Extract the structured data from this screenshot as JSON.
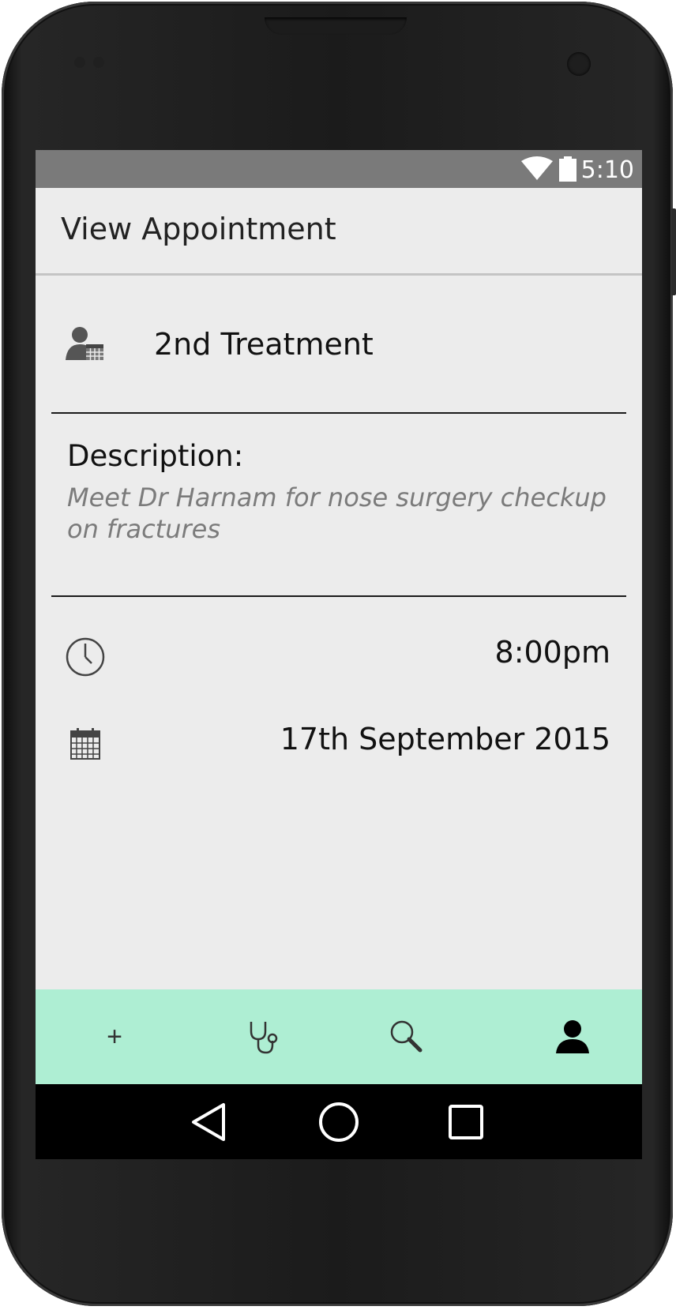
{
  "status_bar": {
    "time": "5:10",
    "wifi_icon": "wifi-icon",
    "battery_icon": "battery-icon"
  },
  "app_bar": {
    "title": "View Appointment"
  },
  "appointment": {
    "icon": "patient-calendar-icon",
    "name": "2nd Treatment",
    "description_label": "Description:",
    "description": "Meet Dr Harnam for nose surgery checkup on fractures",
    "time_icon": "clock-icon",
    "time": "8:00pm",
    "date_icon": "calendar-icon",
    "date": "17th September 2015"
  },
  "bottom_tabs": {
    "background": "#aeeed3",
    "items": [
      {
        "icon": "plus-icon",
        "glyph": "+"
      },
      {
        "icon": "stethoscope-icon"
      },
      {
        "icon": "search-icon"
      },
      {
        "icon": "profile-icon"
      }
    ]
  },
  "nav_bar": {
    "items": [
      "back-icon",
      "home-icon",
      "recents-icon"
    ]
  },
  "colors": {
    "status_bar": "#7a7a7a",
    "screen_bg": "#ececec",
    "description_text": "#7b7b7b"
  }
}
